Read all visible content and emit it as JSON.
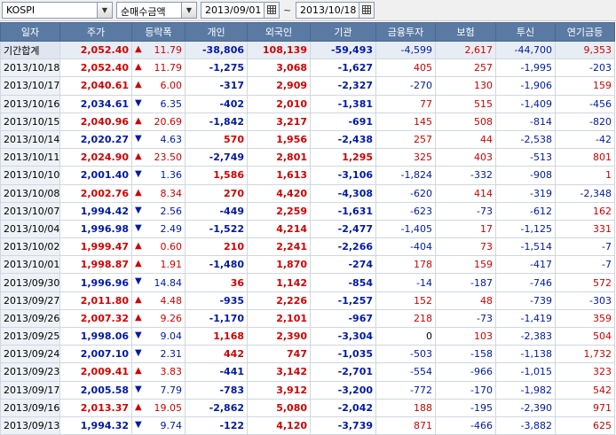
{
  "toolbar": {
    "market": "KOSPI",
    "metric": "순매수금액",
    "date_from": "2013/09/01",
    "date_to": "2013/10/18",
    "tilde": "~"
  },
  "colors": {
    "header_bg": "#5a7aa3",
    "up": "#d20000",
    "down": "#0019a8"
  },
  "columns": [
    "일자",
    "주가",
    "등락폭",
    "개인",
    "외국인",
    "기관",
    "금융투자",
    "보험",
    "투신",
    "연기금등"
  ],
  "rows": [
    {
      "date": "기간합계",
      "price": "2,052.40",
      "dir": "up",
      "chg": "11.79",
      "indiv": "-38,806",
      "foreign": "108,139",
      "inst": "-59,493",
      "fin": "-4,599",
      "ins": "2,617",
      "trust": "-44,700",
      "pension": "9,353"
    },
    {
      "date": "2013/10/18",
      "price": "2,052.40",
      "dir": "up",
      "chg": "11.79",
      "indiv": "-1,275",
      "foreign": "3,068",
      "inst": "-1,627",
      "fin": "405",
      "ins": "257",
      "trust": "-1,995",
      "pension": "-203"
    },
    {
      "date": "2013/10/17",
      "price": "2,040.61",
      "dir": "up",
      "chg": "6.00",
      "indiv": "-317",
      "foreign": "2,909",
      "inst": "-2,327",
      "fin": "-270",
      "ins": "130",
      "trust": "-1,906",
      "pension": "159"
    },
    {
      "date": "2013/10/16",
      "price": "2,034.61",
      "dir": "down",
      "chg": "6.35",
      "indiv": "-402",
      "foreign": "2,010",
      "inst": "-1,381",
      "fin": "77",
      "ins": "515",
      "trust": "-1,409",
      "pension": "-456"
    },
    {
      "date": "2013/10/15",
      "price": "2,040.96",
      "dir": "up",
      "chg": "20.69",
      "indiv": "-1,842",
      "foreign": "3,217",
      "inst": "-691",
      "fin": "145",
      "ins": "508",
      "trust": "-814",
      "pension": "-820"
    },
    {
      "date": "2013/10/14",
      "price": "2,020.27",
      "dir": "down",
      "chg": "4.63",
      "indiv": "570",
      "foreign": "1,956",
      "inst": "-2,438",
      "fin": "257",
      "ins": "44",
      "trust": "-2,538",
      "pension": "-42"
    },
    {
      "date": "2013/10/11",
      "price": "2,024.90",
      "dir": "up",
      "chg": "23.50",
      "indiv": "-2,749",
      "foreign": "2,801",
      "inst": "1,295",
      "fin": "325",
      "ins": "403",
      "trust": "-513",
      "pension": "801"
    },
    {
      "date": "2013/10/10",
      "price": "2,001.40",
      "dir": "down",
      "chg": "1.36",
      "indiv": "1,586",
      "foreign": "1,613",
      "inst": "-3,106",
      "fin": "-1,824",
      "ins": "-332",
      "trust": "-908",
      "pension": "1"
    },
    {
      "date": "2013/10/08",
      "price": "2,002.76",
      "dir": "up",
      "chg": "8.34",
      "indiv": "270",
      "foreign": "4,420",
      "inst": "-4,308",
      "fin": "-620",
      "ins": "414",
      "trust": "-319",
      "pension": "-2,348"
    },
    {
      "date": "2013/10/07",
      "price": "1,994.42",
      "dir": "down",
      "chg": "2.56",
      "indiv": "-449",
      "foreign": "2,259",
      "inst": "-1,631",
      "fin": "-623",
      "ins": "-73",
      "trust": "-612",
      "pension": "162"
    },
    {
      "date": "2013/10/04",
      "price": "1,996.98",
      "dir": "down",
      "chg": "2.49",
      "indiv": "-1,522",
      "foreign": "4,214",
      "inst": "-2,477",
      "fin": "-1,405",
      "ins": "17",
      "trust": "-1,125",
      "pension": "331"
    },
    {
      "date": "2013/10/02",
      "price": "1,999.47",
      "dir": "up",
      "chg": "0.60",
      "indiv": "210",
      "foreign": "2,241",
      "inst": "-2,266",
      "fin": "-404",
      "ins": "73",
      "trust": "-1,514",
      "pension": "-7"
    },
    {
      "date": "2013/10/01",
      "price": "1,998.87",
      "dir": "up",
      "chg": "1.91",
      "indiv": "-1,480",
      "foreign": "1,870",
      "inst": "-274",
      "fin": "178",
      "ins": "159",
      "trust": "-417",
      "pension": "-7"
    },
    {
      "date": "2013/09/30",
      "price": "1,996.96",
      "dir": "down",
      "chg": "14.84",
      "indiv": "36",
      "foreign": "1,142",
      "inst": "-854",
      "fin": "-14",
      "ins": "-187",
      "trust": "-746",
      "pension": "572"
    },
    {
      "date": "2013/09/27",
      "price": "2,011.80",
      "dir": "up",
      "chg": "4.48",
      "indiv": "-935",
      "foreign": "2,226",
      "inst": "-1,257",
      "fin": "152",
      "ins": "48",
      "trust": "-739",
      "pension": "-303"
    },
    {
      "date": "2013/09/26",
      "price": "2,007.32",
      "dir": "up",
      "chg": "9.26",
      "indiv": "-1,170",
      "foreign": "2,101",
      "inst": "-967",
      "fin": "218",
      "ins": "-73",
      "trust": "-1,419",
      "pension": "359"
    },
    {
      "date": "2013/09/25",
      "price": "1,998.06",
      "dir": "down",
      "chg": "9.04",
      "indiv": "1,168",
      "foreign": "2,390",
      "inst": "-3,304",
      "fin": "0",
      "ins": "103",
      "trust": "-2,383",
      "pension": "504"
    },
    {
      "date": "2013/09/24",
      "price": "2,007.10",
      "dir": "down",
      "chg": "2.31",
      "indiv": "442",
      "foreign": "747",
      "inst": "-1,035",
      "fin": "-503",
      "ins": "-158",
      "trust": "-1,138",
      "pension": "1,732"
    },
    {
      "date": "2013/09/23",
      "price": "2,009.41",
      "dir": "up",
      "chg": "3.83",
      "indiv": "-441",
      "foreign": "3,142",
      "inst": "-2,701",
      "fin": "-554",
      "ins": "-966",
      "trust": "-1,015",
      "pension": "323"
    },
    {
      "date": "2013/09/17",
      "price": "2,005.58",
      "dir": "down",
      "chg": "7.79",
      "indiv": "-783",
      "foreign": "3,912",
      "inst": "-3,200",
      "fin": "-772",
      "ins": "-170",
      "trust": "-1,982",
      "pension": "542"
    },
    {
      "date": "2013/09/16",
      "price": "2,013.37",
      "dir": "up",
      "chg": "19.05",
      "indiv": "-2,862",
      "foreign": "5,080",
      "inst": "-2,042",
      "fin": "188",
      "ins": "-195",
      "trust": "-2,390",
      "pension": "971"
    },
    {
      "date": "2013/09/13",
      "price": "1,994.32",
      "dir": "down",
      "chg": "9.74",
      "indiv": "-122",
      "foreign": "4,120",
      "inst": "-3,739",
      "fin": "871",
      "ins": "-466",
      "trust": "-3,882",
      "pension": "625"
    }
  ]
}
